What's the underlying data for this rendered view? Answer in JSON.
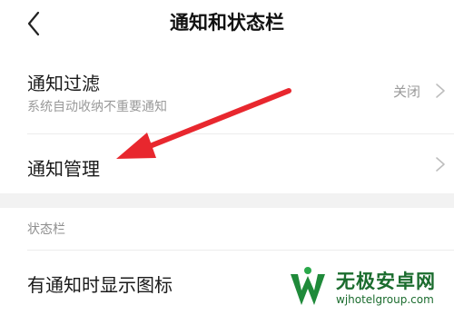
{
  "header": {
    "title": "通知和状态栏",
    "back_icon": "chevron-left-icon"
  },
  "notification_filter": {
    "label": "通知过滤",
    "description": "系统自动收纳不重要通知",
    "value": "关闭",
    "icon": "chevron-right-icon"
  },
  "notification_management": {
    "label": "通知管理",
    "icon": "chevron-right-icon"
  },
  "status_bar_section": {
    "header": "状态栏",
    "items": [
      {
        "label": "有通知时显示图标"
      }
    ]
  },
  "annotation": {
    "type": "arrow",
    "color": "#e8272e"
  },
  "watermark": {
    "name": "无极安卓网",
    "url": "wjhotelgroup.com",
    "color": "#1b6c2e"
  }
}
